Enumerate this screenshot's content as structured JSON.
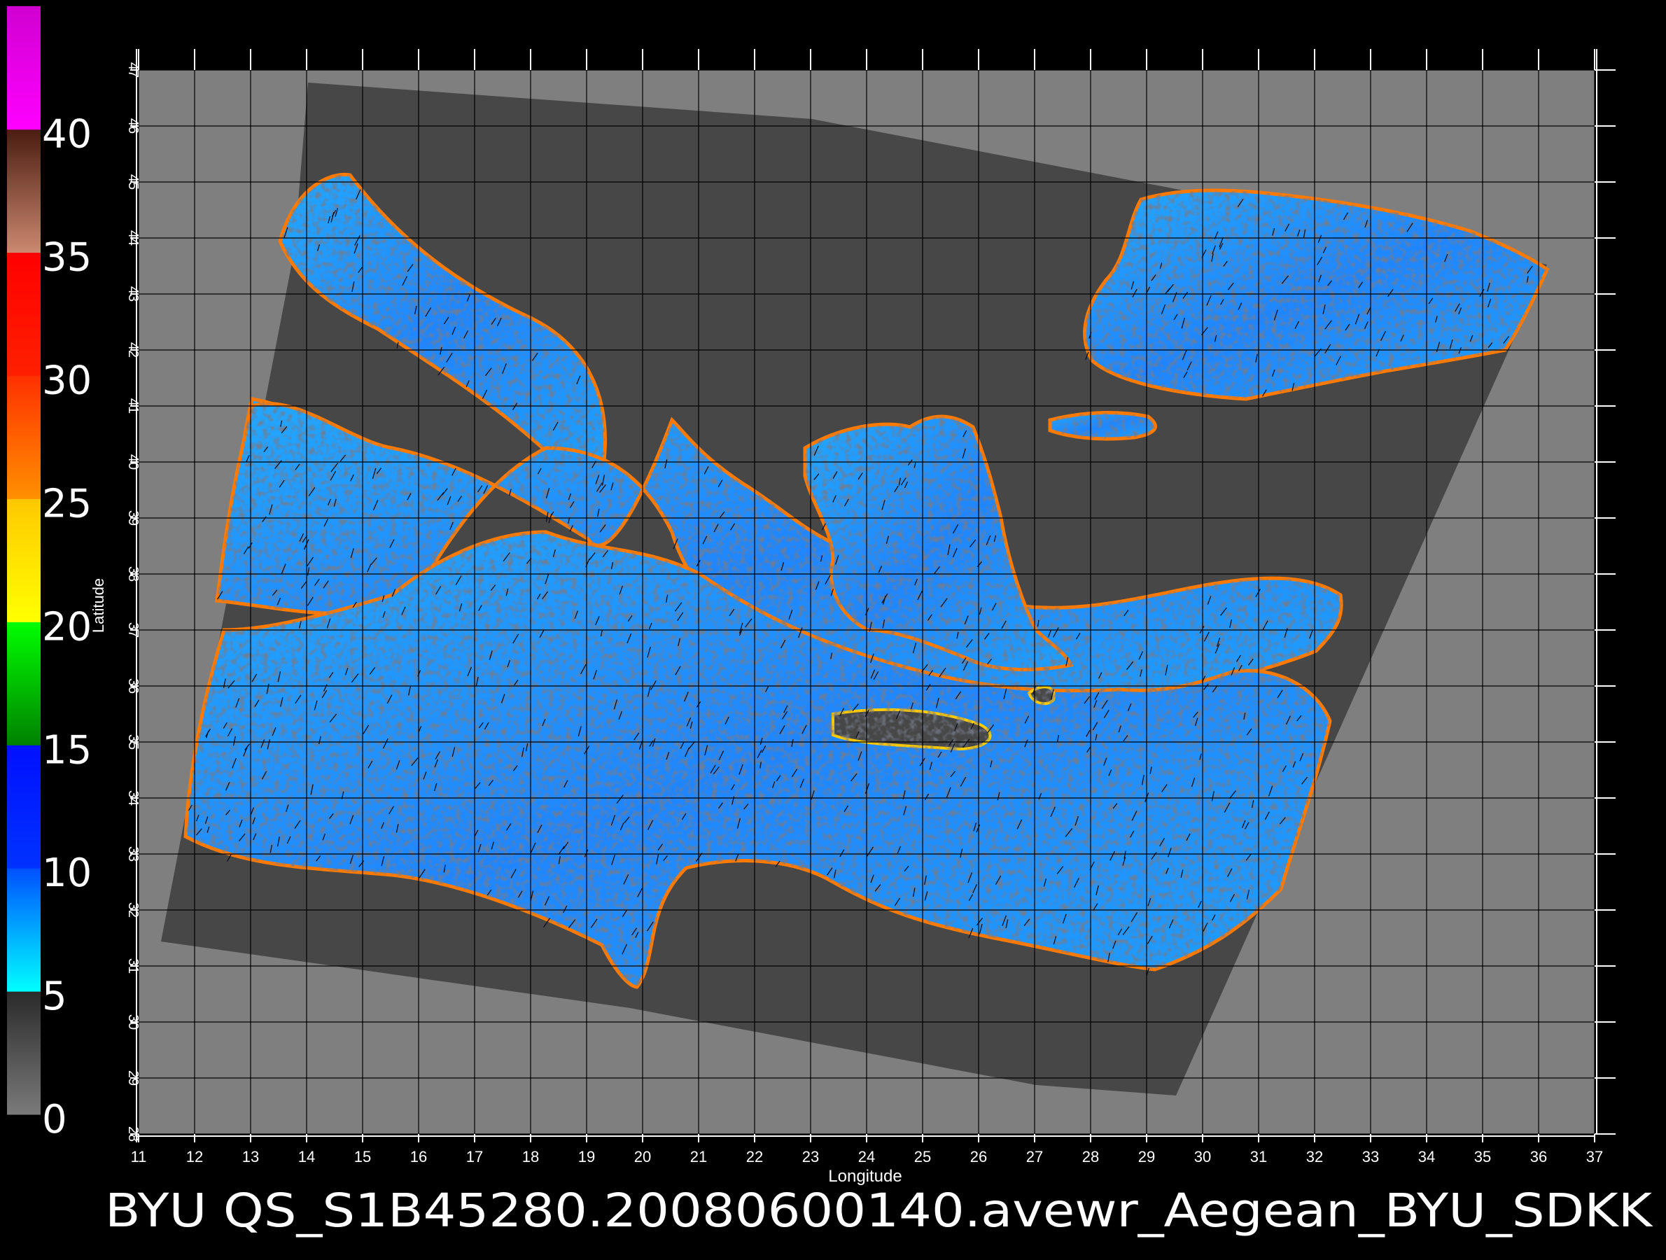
{
  "product_title": "BYU QS_S1B45280.20080600140.avewr_Aegean_BYU_SDKK",
  "x_axis": {
    "label": "Longitude",
    "ticks": [
      "11",
      "12",
      "13",
      "14",
      "15",
      "16",
      "17",
      "18",
      "19",
      "20",
      "21",
      "22",
      "23",
      "24",
      "25",
      "26",
      "27",
      "28",
      "29",
      "30",
      "31",
      "32",
      "33",
      "34",
      "35",
      "36",
      "37"
    ]
  },
  "y_axis": {
    "label": "Latitude",
    "ticks": [
      "28",
      "29",
      "30",
      "31",
      "32",
      "33",
      "34",
      "35",
      "36",
      "37",
      "38",
      "39",
      "40",
      "41",
      "42",
      "43",
      "44",
      "45",
      "46",
      "47"
    ]
  },
  "colorbar": {
    "labels": [
      "0",
      "5",
      "10",
      "15",
      "20",
      "25",
      "30",
      "35",
      "40"
    ],
    "bands": [
      {
        "from": "#7a7a7a",
        "to": "#2a2a2a"
      },
      {
        "from": "#00ffff",
        "to": "#0050ff"
      },
      {
        "from": "#0032ff",
        "to": "#0010ff"
      },
      {
        "from": "#008000",
        "to": "#00ff00"
      },
      {
        "from": "#ffff00",
        "to": "#ffc800"
      },
      {
        "from": "#ff9000",
        "to": "#ff3000"
      },
      {
        "from": "#ff2000",
        "to": "#ff0000"
      },
      {
        "from": "#cc8870",
        "to": "#4a1c10"
      },
      {
        "from": "#ff00ff",
        "to": "#d000d0"
      }
    ]
  },
  "colors": {
    "background": "#000000",
    "land": "#7f7f7f",
    "swath": "#474747",
    "grid": "#000000",
    "sea_low": "#00d8ff",
    "sea_high": "#0a2aff"
  }
}
